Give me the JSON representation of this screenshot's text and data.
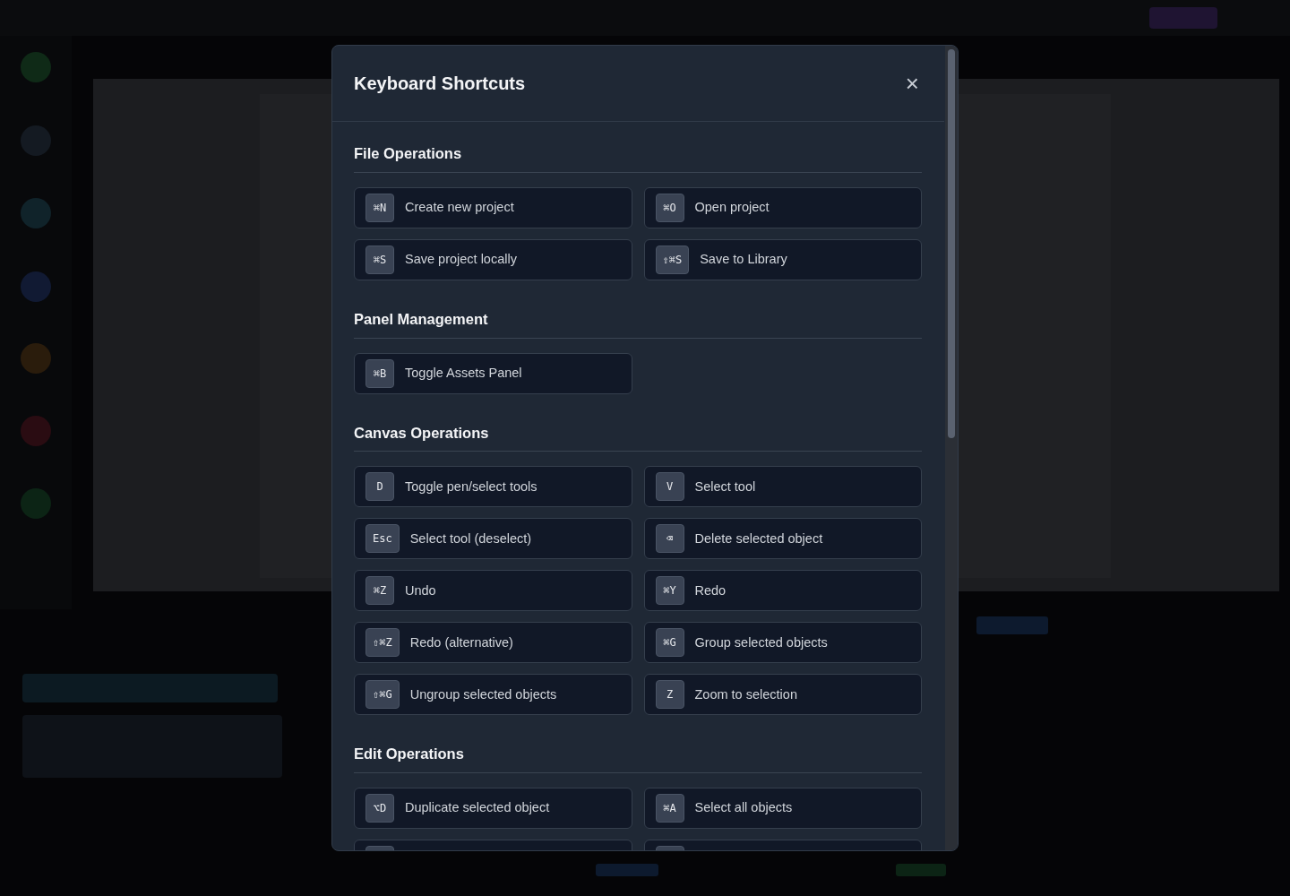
{
  "dialog": {
    "title": "Keyboard Shortcuts",
    "close": "×"
  },
  "sections": [
    {
      "title": "File Operations",
      "items": [
        {
          "kind": "shortcut",
          "keys": "⌘N",
          "label": "Create new project"
        },
        {
          "kind": "shortcut",
          "keys": "⌘O",
          "label": "Open project"
        },
        {
          "kind": "shortcut",
          "keys": "⌘S",
          "label": "Save project locally"
        },
        {
          "kind": "shortcut",
          "keys": "⇧⌘S",
          "label": "Save to Library"
        }
      ]
    },
    {
      "title": "Panel Management",
      "items": [
        {
          "kind": "shortcut",
          "keys": "⌘B",
          "label": "Toggle Assets Panel"
        }
      ]
    },
    {
      "title": "Canvas Operations",
      "items": [
        {
          "kind": "shortcut",
          "keys": "D",
          "label": "Toggle pen/select tools"
        },
        {
          "kind": "shortcut",
          "keys": "V",
          "label": "Select tool"
        },
        {
          "kind": "shortcut",
          "keys": "Esc",
          "label": "Select tool (deselect)"
        },
        {
          "kind": "shortcut",
          "keys": "⌫",
          "label": "Delete selected object"
        },
        {
          "kind": "shortcut",
          "keys": "⌘Z",
          "label": "Undo"
        },
        {
          "kind": "shortcut",
          "keys": "⌘Y",
          "label": "Redo"
        },
        {
          "kind": "shortcut",
          "keys": "⇧⌘Z",
          "label": "Redo (alternative)"
        },
        {
          "kind": "shortcut",
          "keys": "⌘G",
          "label": "Group selected objects"
        },
        {
          "kind": "shortcut",
          "keys": "⇧⌘G",
          "label": "Ungroup selected objects"
        },
        {
          "kind": "shortcut",
          "keys": "Z",
          "label": "Zoom to selection"
        }
      ]
    },
    {
      "title": "Edit Operations",
      "items": [
        {
          "kind": "shortcut",
          "keys": "⌥D",
          "label": "Duplicate selected object"
        },
        {
          "kind": "shortcut",
          "keys": "⌘A",
          "label": "Select all objects"
        },
        {
          "kind": "cutoff"
        },
        {
          "kind": "cutoff"
        }
      ]
    }
  ]
}
